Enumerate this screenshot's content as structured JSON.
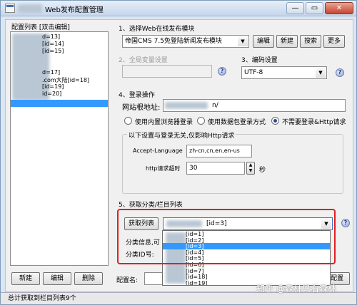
{
  "window": {
    "title": "Web发布配置管理",
    "min_label": "—",
    "max_label": "▭",
    "close_label": "✕"
  },
  "config_list": {
    "header": "配置列表 [双击编辑]",
    "items": [
      {
        "text": "d=13]",
        "selected": false
      },
      {
        "text": "[id=14]",
        "selected": false
      },
      {
        "text": "[id=15]",
        "selected": false
      },
      {
        "text": "",
        "selected": false
      },
      {
        "text": "",
        "selected": false
      },
      {
        "text": "d=17]",
        "selected": false
      },
      {
        "text": ".com大陆[id=18]",
        "selected": false
      },
      {
        "text": "[id=19]",
        "selected": false
      },
      {
        "text": "id=20]",
        "selected": false
      },
      {
        "text": "",
        "selected": true
      }
    ],
    "new_label": "新建",
    "edit_label": "编辑",
    "delete_label": "删除"
  },
  "section1": {
    "label": "1、选择Web在线发布模块",
    "module_value": "帝国CMS 7.5免登陆新闻发布模块",
    "edit_label": "编辑",
    "new_label": "新建",
    "search_label": "搜索",
    "more_label": "更多"
  },
  "section2": {
    "label": "2、全局变量设置",
    "value": ""
  },
  "section3": {
    "label": "3、编码设置",
    "value": "UTF-8"
  },
  "section4": {
    "label": "4、登录操作",
    "site_label": "网站根地址:",
    "site_value": "n/",
    "radio_builtin": "使用内置浏览器登录",
    "radio_packet": "使用数据包登录方式",
    "radio_none": "不需要登录&Http请求",
    "note": "以下设置与登录无关,仅影响Http请求",
    "accept_language_label": "Accept-Language",
    "accept_language_value": "zh-cn,cn,en,en-us",
    "timeout_label": "http请求超时",
    "timeout_value": "30",
    "timeout_unit": "秒"
  },
  "section5": {
    "label": "5、获取分类/栏目列表",
    "fetch_label": "获取列表",
    "selected_value": "[id=3]",
    "category_info_label": "分类信息,可",
    "category_id_label": "分类ID号:",
    "dropdown_items": [
      {
        "text": "[id=1]",
        "selected": false
      },
      {
        "text": "[id=2]",
        "selected": false
      },
      {
        "text": "[id=3]",
        "selected": true
      },
      {
        "text": "[id=4]",
        "selected": false
      },
      {
        "text": "[id=5]",
        "selected": false
      },
      {
        "text": "[id=6]",
        "selected": false
      },
      {
        "text": "[id=7]",
        "selected": false
      },
      {
        "text": "[id=18]",
        "selected": false
      },
      {
        "text": "[id=19]",
        "selected": false
      }
    ]
  },
  "footer": {
    "config_name_label": "配置名:",
    "config_save_label": "配置"
  },
  "status": {
    "text": "总计获取到栏目列表9个"
  },
  "watermark": "知乎 @森林只看森林"
}
